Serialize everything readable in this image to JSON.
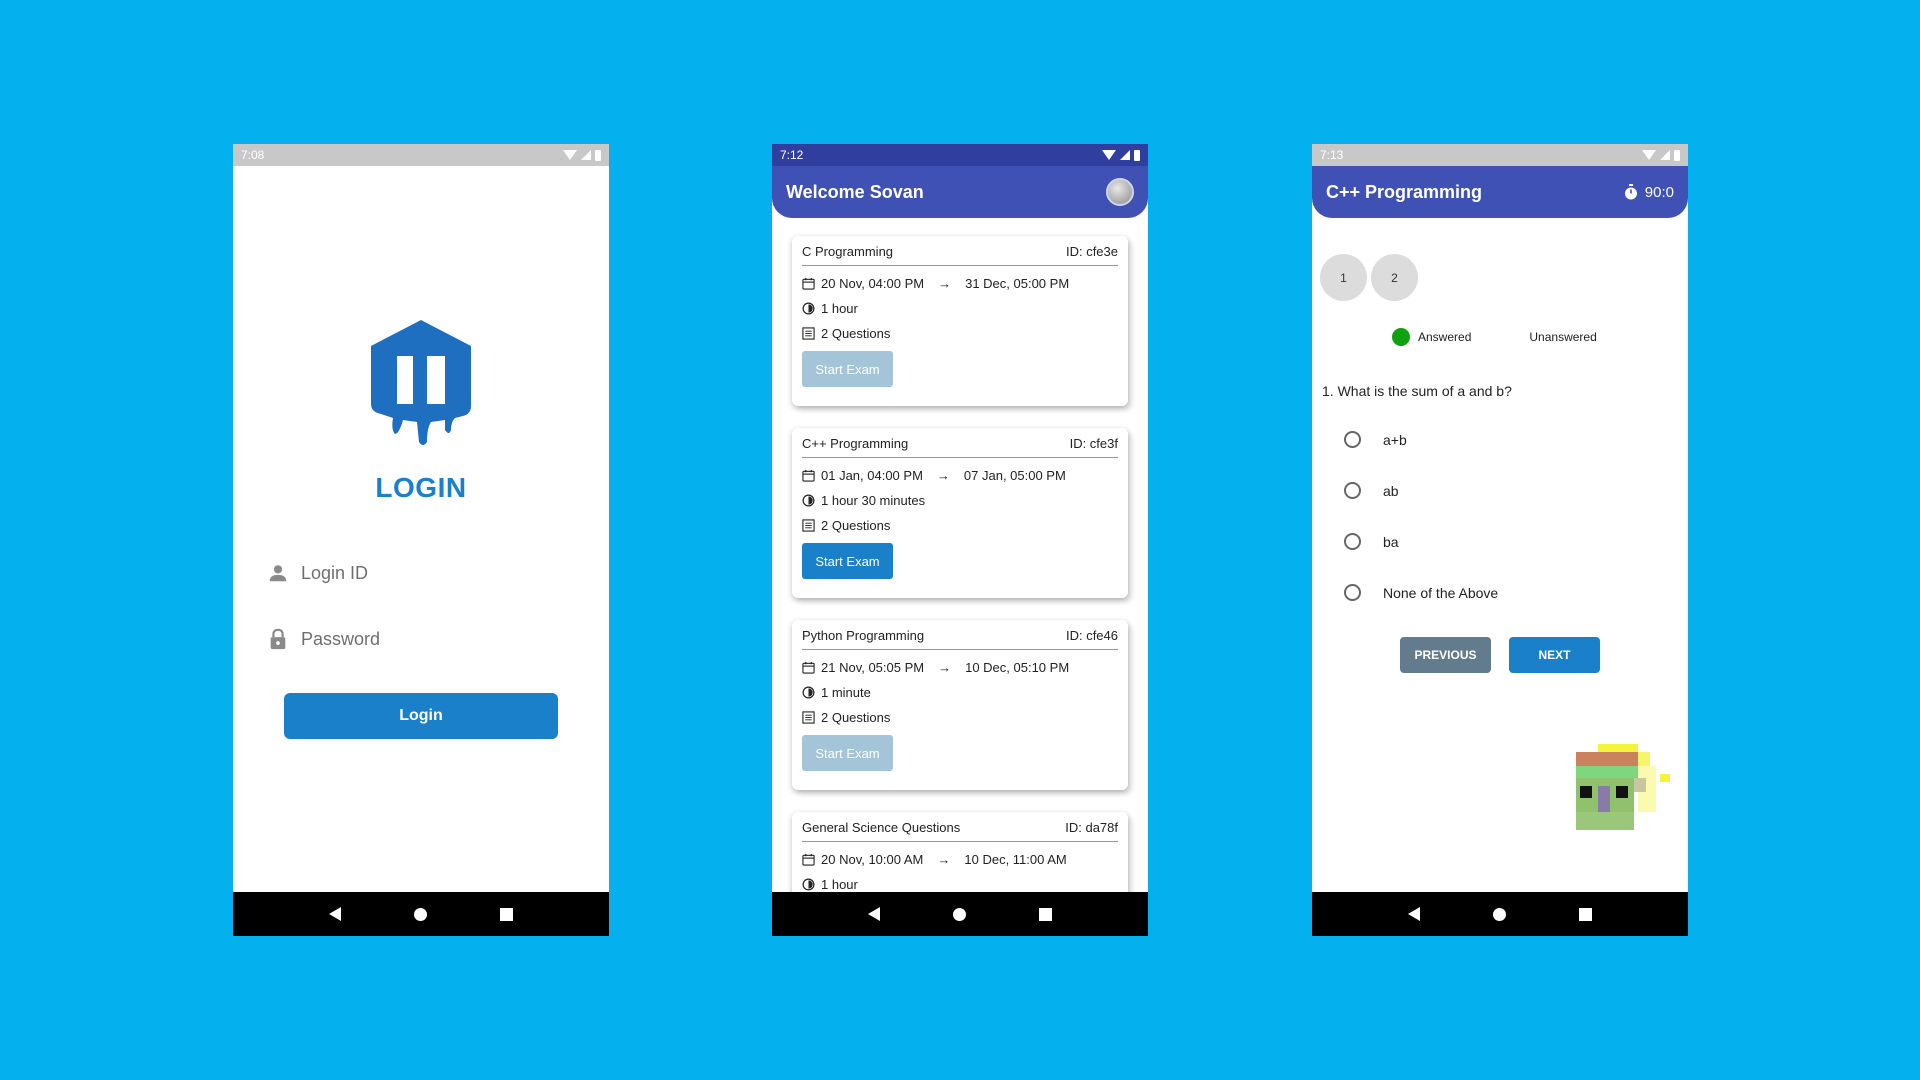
{
  "login_screen": {
    "status_time": "7:08",
    "title": "LOGIN",
    "login_id_placeholder": "Login ID",
    "password_placeholder": "Password",
    "login_button": "Login"
  },
  "list_screen": {
    "status_time": "7:12",
    "title": "Welcome Sovan",
    "cards": [
      {
        "name": "C Programming",
        "id": "ID: cfe3e",
        "start": "20 Nov, 04:00 PM",
        "end": "31 Dec, 05:00 PM",
        "duration": "1 hour",
        "questions": "2 Questions",
        "button": "Start Exam",
        "enabled": false
      },
      {
        "name": "C++ Programming",
        "id": "ID: cfe3f",
        "start": "01 Jan, 04:00 PM",
        "end": "07 Jan, 05:00 PM",
        "duration": "1 hour 30 minutes",
        "questions": "2 Questions",
        "button": "Start Exam",
        "enabled": true
      },
      {
        "name": "Python Programming",
        "id": "ID: cfe46",
        "start": "21 Nov, 05:05 PM",
        "end": "10 Dec, 05:10 PM",
        "duration": "1 minute",
        "questions": "2 Questions",
        "button": "Start Exam",
        "enabled": false
      },
      {
        "name": "General Science Questions",
        "id": "ID: da78f",
        "start": "20 Nov, 10:00 AM",
        "end": "10 Dec, 11:00 AM",
        "duration": "1 hour",
        "questions": "",
        "button": "",
        "enabled": false
      }
    ]
  },
  "exam_screen": {
    "status_time": "7:13",
    "title": "C++ Programming",
    "timer": "90:0",
    "question_numbers": [
      "1",
      "2"
    ],
    "legend_answered": "Answered",
    "legend_unanswered": "Unanswered",
    "question": "1.  What is the sum of a and b?",
    "options": [
      "a+b",
      "ab",
      "ba",
      "None of the Above"
    ],
    "previous_button": "PREVIOUS",
    "next_button": "NEXT"
  },
  "colors": {
    "background": "#04b0ee",
    "primary": "#1a80c9",
    "appbar": "#3f51b5",
    "answered": "#0fa10f"
  }
}
